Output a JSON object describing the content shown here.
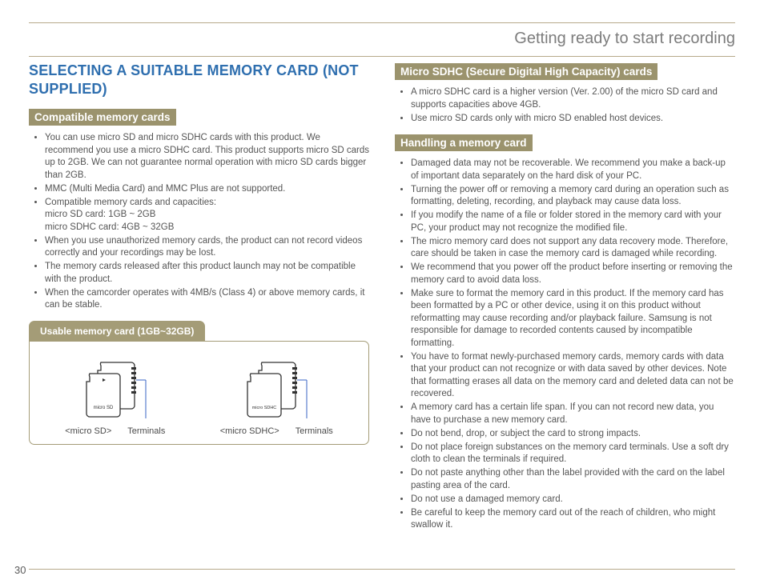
{
  "chapter_title": "Getting ready to start recording",
  "heading": "SELECTING A SUITABLE MEMORY CARD (NOT SUPPLIED)",
  "page_number": "30",
  "left": {
    "subhead1": "Compatible memory cards",
    "list1": [
      "You can use micro SD and micro SDHC cards with this product. We recommend you use a micro SDHC card. This product supports micro SD cards up to 2GB. We can not guarantee normal operation with micro SD cards bigger than 2GB.",
      "MMC (Multi Media Card) and MMC Plus are not supported.",
      "Compatible memory cards and capacities:\nmicro SD card: 1GB ~ 2GB\nmicro SDHC card: 4GB ~ 32GB",
      "When you use unauthorized memory cards, the product can not record videos correctly and your recordings may be lost.",
      "The memory cards released after this product launch may not be compatible with the product.",
      "When the camcorder operates with 4MB/s (Class 4) or above memory cards, it can be stable."
    ],
    "callout_title": "Usable memory card (1GB~32GB)",
    "card1_label": "<micro SD>",
    "card2_label": "<micro SDHC>",
    "terminals_label": "Terminals",
    "card1_logo": "micro SD",
    "card2_logo": "micro SDHC"
  },
  "right": {
    "subhead1": "Micro SDHC (Secure Digital High Capacity) cards",
    "list1": [
      "A micro SDHC card is a higher version (Ver. 2.00) of the micro SD card and supports capacities above 4GB.",
      "Use micro SD cards only with micro SD enabled host devices."
    ],
    "subhead2": "Handling a memory card",
    "list2": [
      "Damaged data may not be recoverable. We recommend you make a back-up of important data separately on the hard disk of your PC.",
      "Turning the power off or removing a memory card during an operation such as formatting, deleting, recording, and playback may cause data loss.",
      "If you modify the name of a file or folder stored in the memory card with your PC, your product may not recognize the modified file.",
      "The micro memory card does not support any data recovery mode. Therefore, care should be taken in case the memory card is damaged while recording.",
      "We recommend that you power off the product before inserting or removing the memory card to avoid data loss.",
      "Make sure to format the memory card in this product. If the memory card has been formatted by a PC or other device, using it on this product without reformatting may cause recording and/or playback failure. Samsung is not responsible for damage to recorded contents caused by incompatible formatting.",
      "You have to format newly-purchased memory cards, memory cards with data that your product can not recognize or with data saved by other devices. Note that formatting erases all data on the memory card and deleted data can not be recovered.",
      "A memory card has a certain life span. If you can not record new data, you have to purchase a new memory card.",
      "Do not bend, drop, or subject the card to strong impacts.",
      "Do not place foreign substances on the memory card terminals. Use a soft dry cloth to clean the terminals if required.",
      "Do not paste anything other than the label provided with the card on the label pasting area of the card.",
      "Do not use a damaged memory card.",
      "Be careful to keep the memory card out of the reach of children, who might swallow it."
    ]
  }
}
